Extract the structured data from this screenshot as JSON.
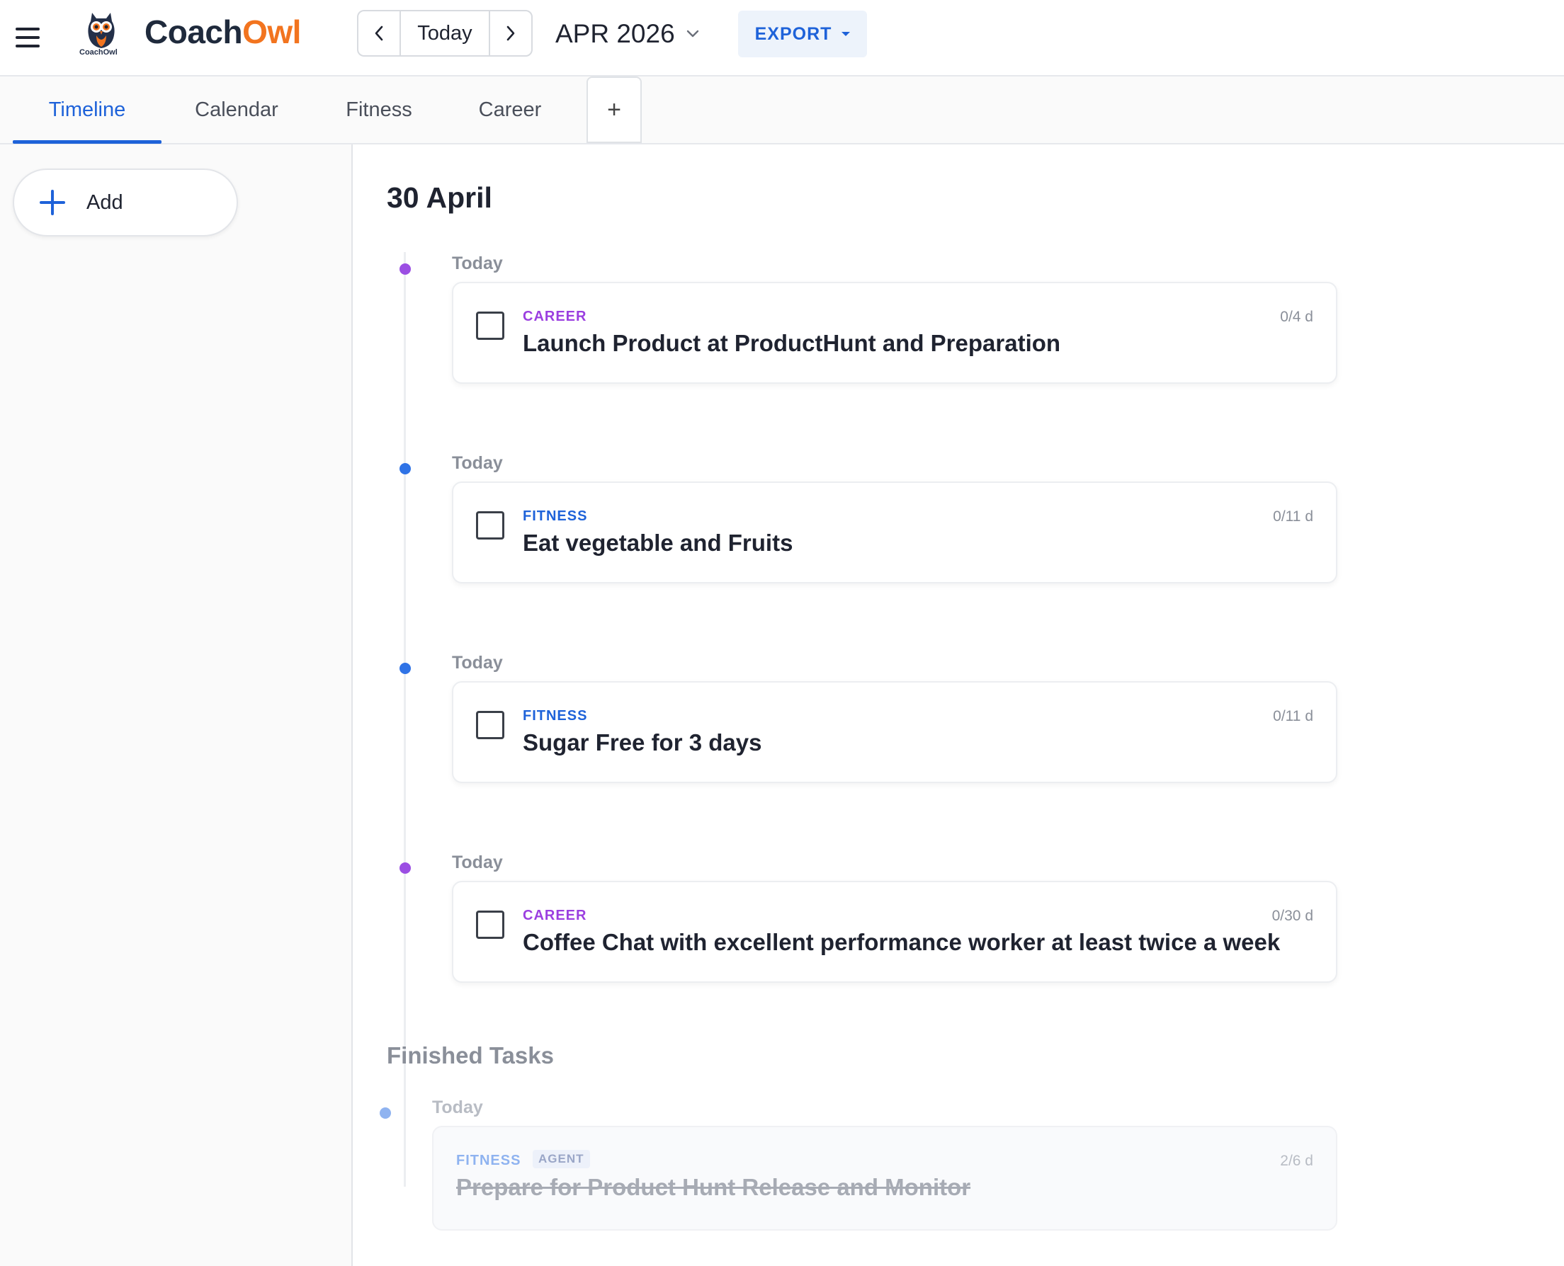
{
  "app": {
    "brand_part1": "Coach",
    "brand_part2": "Owl",
    "logo_caption": "CoachOwl"
  },
  "header": {
    "today_label": "Today",
    "month_label": "APR 2026",
    "export_label": "EXPORT"
  },
  "tabs": [
    {
      "label": "Timeline",
      "active": true
    },
    {
      "label": "Calendar",
      "active": false
    },
    {
      "label": "Fitness",
      "active": false
    },
    {
      "label": "Career",
      "active": false
    }
  ],
  "tab_add_label": "+",
  "sidebar": {
    "add_label": "Add"
  },
  "timeline": {
    "date_heading": "30 April",
    "tasks": [
      {
        "day": "Today",
        "category": "CAREER",
        "title": "Launch Product at ProductHunt and Preparation",
        "progress": "0/4 d"
      },
      {
        "day": "Today",
        "category": "FITNESS",
        "title": "Eat vegetable and Fruits",
        "progress": "0/11 d"
      },
      {
        "day": "Today",
        "category": "FITNESS",
        "title": "Sugar Free for 3 days",
        "progress": "0/11 d"
      },
      {
        "day": "Today",
        "category": "CAREER",
        "title": "Coffee Chat with excellent performance worker at least twice a week",
        "progress": "0/30 d"
      }
    ],
    "finished_heading": "Finished Tasks",
    "finished": [
      {
        "day": "Today",
        "category": "FITNESS",
        "badge": "AGENT",
        "title": "Prepare for Product Hunt Release and Monitor",
        "progress": "2/6 d"
      }
    ]
  },
  "colors": {
    "accent": "#1e62d9",
    "career": "#9b3fe0",
    "fitness": "#1e62d9",
    "brand_orange": "#f2741f",
    "brand_navy": "#1f2a3c"
  },
  "icons": [
    "hamburger-menu-icon",
    "owl-logo-icon",
    "chevron-left-icon",
    "chevron-right-icon",
    "chevron-down-icon",
    "caret-down-icon",
    "plus-icon"
  ]
}
